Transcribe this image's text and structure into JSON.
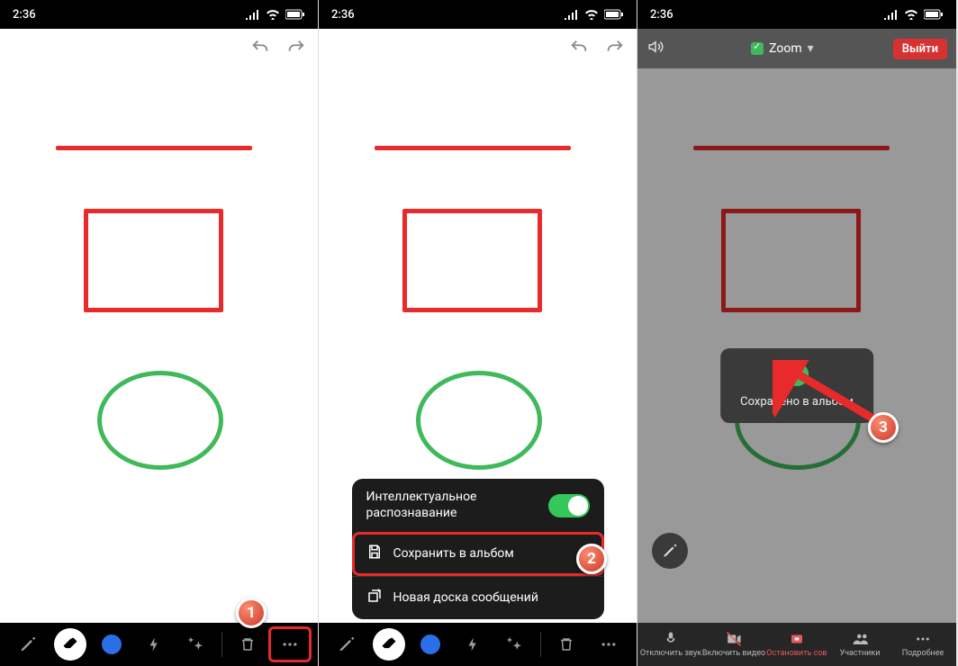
{
  "status": {
    "time": "2:36"
  },
  "toolbar": {
    "pen": "pen",
    "eraser": "eraser",
    "color": "color",
    "lightning": "spotlight",
    "wand": "smart-recognition",
    "trash": "clear",
    "more": "more"
  },
  "popup": {
    "smart_recognition": "Интеллектуальное распознавание",
    "save_to_album": "Сохранить в альбом",
    "new_whiteboard": "Новая доска сообщений"
  },
  "zoom_header": {
    "title": "Zoom",
    "exit": "Выйти"
  },
  "toast": {
    "msg": "Сохранено в альбом"
  },
  "zoombar": {
    "mute": "Отключить звук",
    "video": "Включить видео",
    "stop_share": "Остановить сов",
    "participants": "Участники",
    "more": "Подробнее"
  },
  "steps": {
    "s1": "1",
    "s2": "2",
    "s3": "3"
  }
}
